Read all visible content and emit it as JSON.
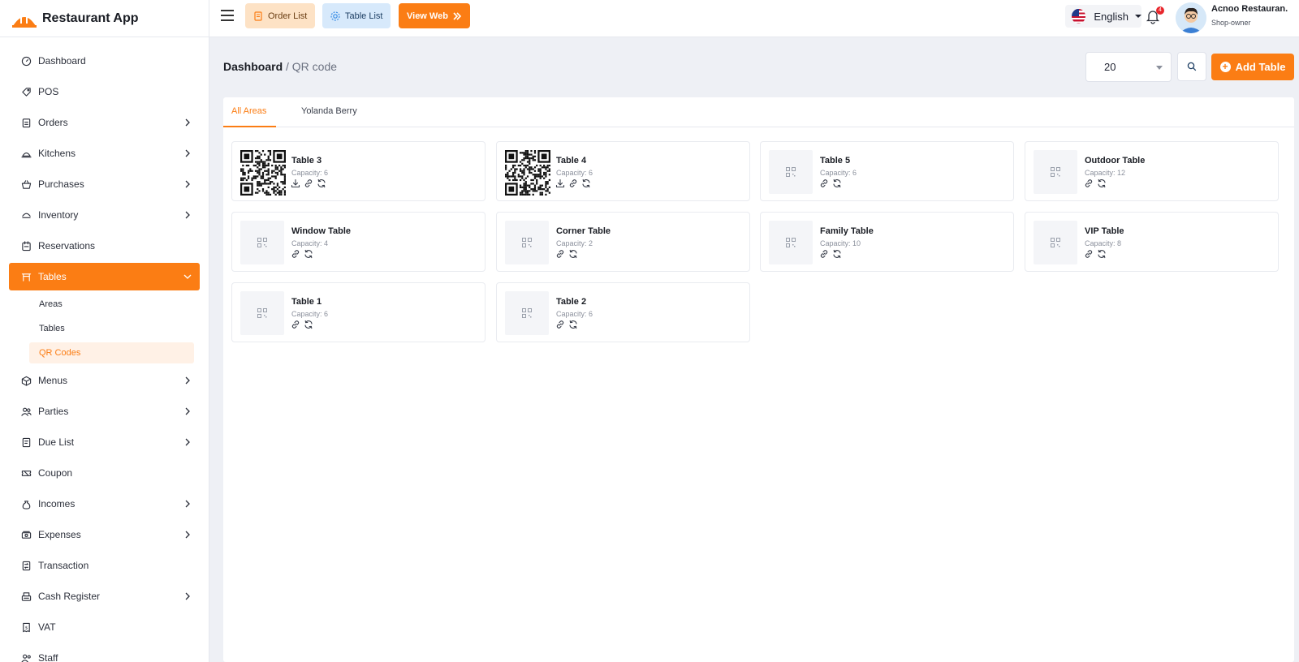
{
  "app": {
    "name": "Restaurant App"
  },
  "sidebar": {
    "items": [
      {
        "label": "Dashboard",
        "icon": "dashboard-icon",
        "chevron": false
      },
      {
        "label": "POS",
        "icon": "tag-icon",
        "chevron": false
      },
      {
        "label": "Orders",
        "icon": "clipboard-icon",
        "chevron": true
      },
      {
        "label": "Kitchens",
        "icon": "cloche-icon",
        "chevron": true
      },
      {
        "label": "Purchases",
        "icon": "basket-icon",
        "chevron": true
      },
      {
        "label": "Inventory",
        "icon": "inventory-icon",
        "chevron": true
      },
      {
        "label": "Reservations",
        "icon": "calendar-icon",
        "chevron": false
      },
      {
        "label": "Tables",
        "icon": "table-icon",
        "chevron": true,
        "active": true
      },
      {
        "label": "Menus",
        "icon": "box-icon",
        "chevron": true
      },
      {
        "label": "Parties",
        "icon": "users-icon",
        "chevron": true
      },
      {
        "label": "Due List",
        "icon": "invoice-icon",
        "chevron": true
      },
      {
        "label": "Coupon",
        "icon": "ticket-icon",
        "chevron": false
      },
      {
        "label": "Incomes",
        "icon": "money-bag-icon",
        "chevron": true
      },
      {
        "label": "Expenses",
        "icon": "cash-icon",
        "chevron": true
      },
      {
        "label": "Transaction",
        "icon": "transaction-icon",
        "chevron": false
      },
      {
        "label": "Cash Register",
        "icon": "register-icon",
        "chevron": true
      },
      {
        "label": "VAT",
        "icon": "receipt-icon",
        "chevron": false
      },
      {
        "label": "Staff",
        "icon": "staff-icon",
        "chevron": false
      }
    ],
    "subitems": [
      {
        "label": "Areas"
      },
      {
        "label": "Tables"
      },
      {
        "label": "QR Codes",
        "active": true
      }
    ]
  },
  "topbar": {
    "order_list": "Order List",
    "table_list": "Table List",
    "view_web": "View Web",
    "language": "English",
    "notification_count": "4",
    "user_name": "Acnoo Restauran.",
    "user_role": "Shop-owner"
  },
  "breadcrumb": {
    "root": "Dashboard",
    "current": "/ QR code"
  },
  "toolbar": {
    "per_page": "20",
    "add_table": "Add Table"
  },
  "tabs": [
    {
      "label": "All Areas"
    },
    {
      "label": "Yolanda Berry"
    }
  ],
  "cards": [
    {
      "name": "Table 3",
      "capacity": "Capacity: 6",
      "has_qr": true
    },
    {
      "name": "Table 4",
      "capacity": "Capacity: 6",
      "has_qr": true
    },
    {
      "name": "Table 5",
      "capacity": "Capacity: 6",
      "has_qr": false
    },
    {
      "name": "Outdoor Table",
      "capacity": "Capacity: 12",
      "has_qr": false
    },
    {
      "name": "Window Table",
      "capacity": "Capacity: 4",
      "has_qr": false
    },
    {
      "name": "Corner Table",
      "capacity": "Capacity: 2",
      "has_qr": false
    },
    {
      "name": "Family Table",
      "capacity": "Capacity: 10",
      "has_qr": false
    },
    {
      "name": "VIP Table",
      "capacity": "Capacity: 8",
      "has_qr": false
    },
    {
      "name": "Table 1",
      "capacity": "Capacity: 6",
      "has_qr": false
    },
    {
      "name": "Table 2",
      "capacity": "Capacity: 6",
      "has_qr": false
    }
  ],
  "colors": {
    "accent": "#fb7d14",
    "accent_light": "#fff1e6",
    "danger": "#e8262c"
  }
}
